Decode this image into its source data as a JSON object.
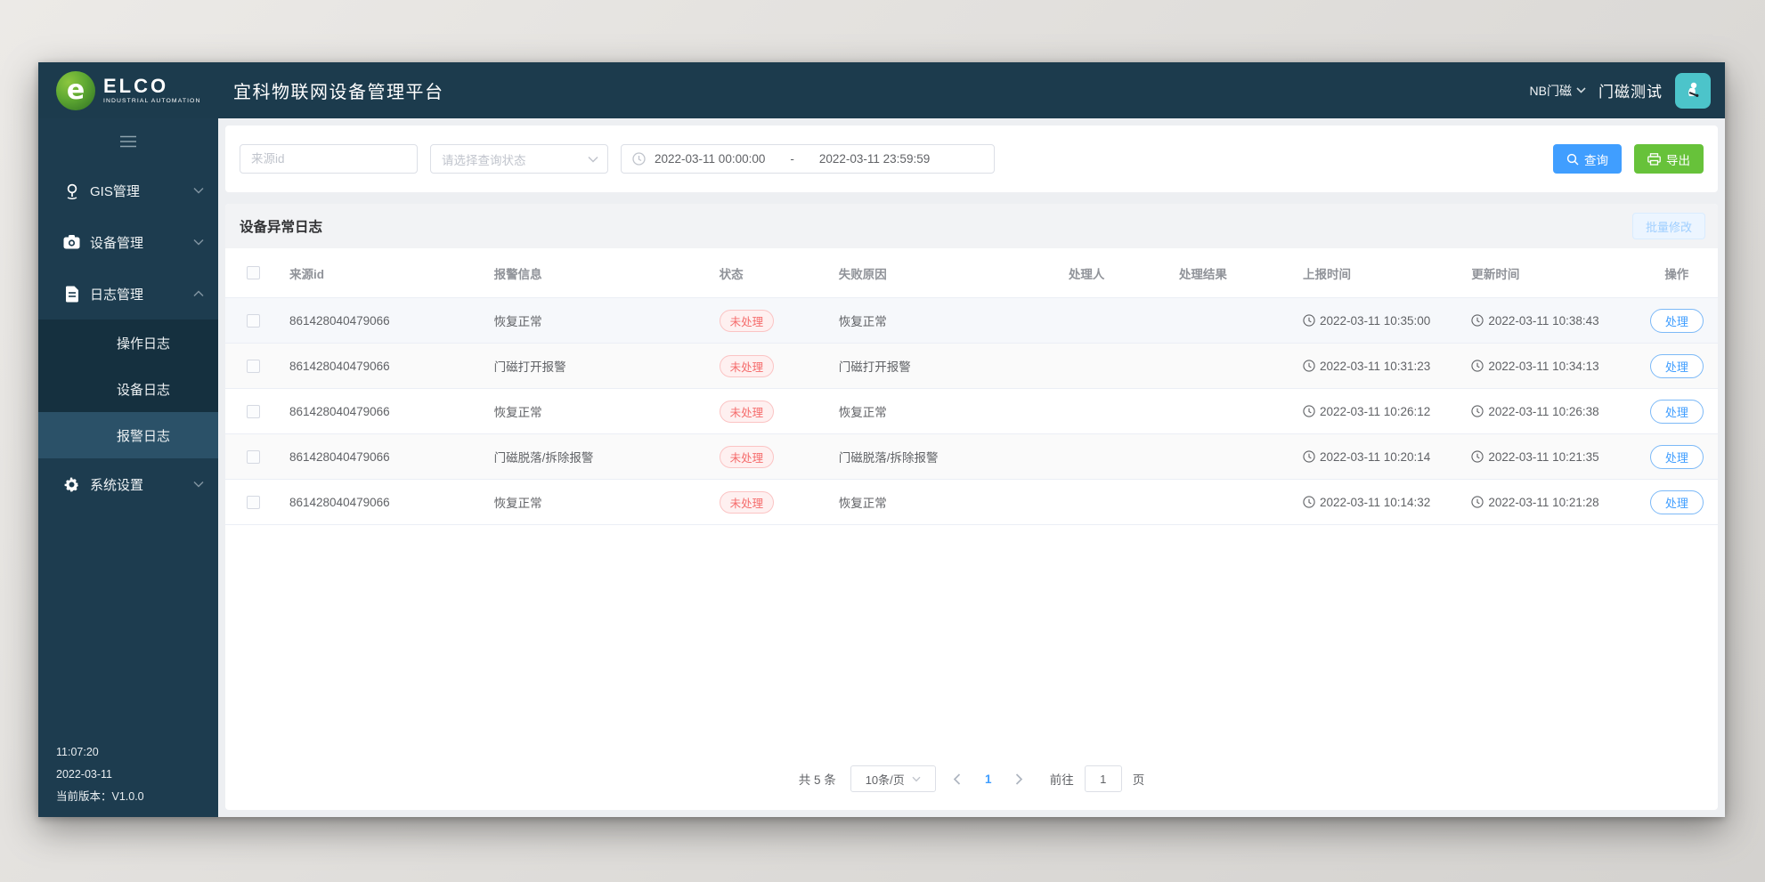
{
  "header": {
    "brand": "ELCO",
    "brand_tagline": "INDUSTRIAL AUTOMATION",
    "title": "宜科物联网设备管理平台",
    "product_select": "NB门磁",
    "username": "门磁测试"
  },
  "sidebar": {
    "menu": [
      {
        "label": "GIS管理",
        "icon": "location-pin-icon"
      },
      {
        "label": "设备管理",
        "icon": "camera-icon"
      },
      {
        "label": "日志管理",
        "icon": "document-icon",
        "children": [
          "操作日志",
          "设备日志",
          "报警日志"
        ]
      },
      {
        "label": "系统设置",
        "icon": "gear-icon"
      }
    ],
    "active_submenu": "报警日志",
    "clock_time": "11:07:20",
    "clock_date": "2022-03-11",
    "version": "当前版本：V1.0.0"
  },
  "filters": {
    "source_placeholder": "来源id",
    "status_placeholder": "请选择查询状态",
    "date_start": "2022-03-11 00:00:00",
    "date_sep": "-",
    "date_end": "2022-03-11 23:59:59",
    "search": "查询",
    "export": "导出"
  },
  "table": {
    "title": "设备异常日志",
    "batch_edit": "批量修改",
    "columns": [
      "来源id",
      "报警信息",
      "状态",
      "失败原因",
      "处理人",
      "处理结果",
      "上报时间",
      "更新时间",
      "操作"
    ],
    "action": "处理",
    "rows": [
      {
        "id": "861428040479066",
        "alarm": "恢复正常",
        "status": "未处理",
        "reason": "恢复正常",
        "handler": "",
        "result": "",
        "reported": "2022-03-11 10:35:00",
        "updated": "2022-03-11 10:38:43"
      },
      {
        "id": "861428040479066",
        "alarm": "门磁打开报警",
        "status": "未处理",
        "reason": "门磁打开报警",
        "handler": "",
        "result": "",
        "reported": "2022-03-11 10:31:23",
        "updated": "2022-03-11 10:34:13"
      },
      {
        "id": "861428040479066",
        "alarm": "恢复正常",
        "status": "未处理",
        "reason": "恢复正常",
        "handler": "",
        "result": "",
        "reported": "2022-03-11 10:26:12",
        "updated": "2022-03-11 10:26:38"
      },
      {
        "id": "861428040479066",
        "alarm": "门磁脱落/拆除报警",
        "status": "未处理",
        "reason": "门磁脱落/拆除报警",
        "handler": "",
        "result": "",
        "reported": "2022-03-11 10:20:14",
        "updated": "2022-03-11 10:21:35"
      },
      {
        "id": "861428040479066",
        "alarm": "恢复正常",
        "status": "未处理",
        "reason": "恢复正常",
        "handler": "",
        "result": "",
        "reported": "2022-03-11 10:14:32",
        "updated": "2022-03-11 10:21:28"
      }
    ]
  },
  "pagination": {
    "total": "共 5 条",
    "page_size": "10条/页",
    "page": "1",
    "goto": "前往",
    "goto_value": "1",
    "unit": "页"
  },
  "colors": {
    "header_bg": "#1c3b4d",
    "submenu_bg": "#15303f",
    "active_menu_bg": "#2b5168",
    "primary": "#409eff",
    "success": "#67c23a",
    "danger": "#f56c6c",
    "avatar_bg": "#4cc4ca"
  }
}
